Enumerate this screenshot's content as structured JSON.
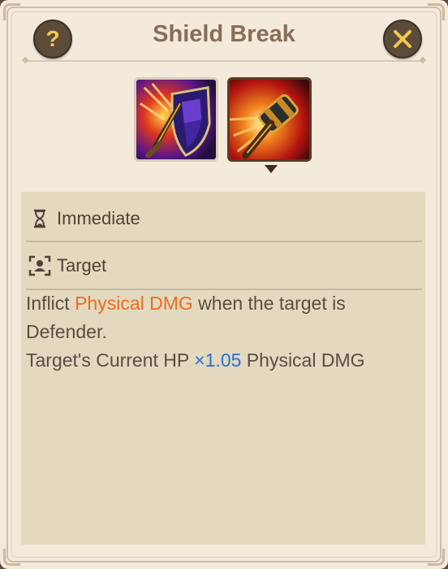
{
  "dialog": {
    "title": "Shield Break",
    "help_icon": "question-mark-icon",
    "close_icon": "close-x-icon",
    "help_label": "?"
  },
  "skills": [
    {
      "name": "shield-skill-icon",
      "selected": false
    },
    {
      "name": "hammer-skill-icon",
      "selected": true
    }
  ],
  "info": {
    "cast_type": {
      "icon": "hourglass-icon",
      "label": "Immediate"
    },
    "target": {
      "icon": "target-person-icon",
      "label": "Target"
    },
    "description": {
      "line1_prefix": "Inflict ",
      "line1_highlight": "Physical DMG",
      "line1_suffix": " when the target is",
      "line2": "Defender.",
      "line3_prefix": "Target's Current HP ",
      "line3_multiplier": "×1.05",
      "line3_suffix": " Physical DMG"
    }
  },
  "colors": {
    "highlight_orange": "#ee6c1f",
    "highlight_blue": "#2b6fd2",
    "title": "#8a6d58",
    "panel_bg": "#f3eadc",
    "info_bg": "#e2d9bf"
  }
}
